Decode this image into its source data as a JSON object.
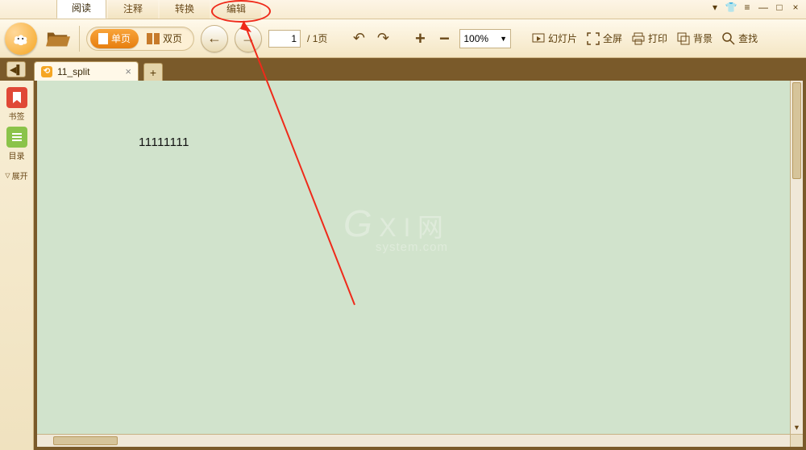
{
  "menu": {
    "tabs": [
      "阅读",
      "注释",
      "转换",
      "编辑"
    ],
    "active_index": 0,
    "highlighted_index": 3
  },
  "window_controls": {
    "hide": "▾",
    "shirt": "👕",
    "menu": "≡",
    "min": "—",
    "max": "□",
    "close": "×"
  },
  "toolbar": {
    "view_modes": {
      "single": "单页",
      "double": "双页"
    },
    "page": {
      "current": "1",
      "total": "/ 1页"
    },
    "zoom": "100%",
    "buttons": {
      "slideshow": "幻灯片",
      "fullscreen": "全屏",
      "print": "打印",
      "background": "背景",
      "search": "查找"
    }
  },
  "tabs": {
    "doc_name": "11_split",
    "doc_icon": "⟲"
  },
  "sidebar": {
    "bookmark": "书签",
    "toc": "目录",
    "expand": "展开"
  },
  "content": {
    "text": "11111111"
  },
  "watermark": {
    "line1a": "G",
    "line1b": "X I",
    "line1c": "网",
    "line2": "system.com"
  }
}
